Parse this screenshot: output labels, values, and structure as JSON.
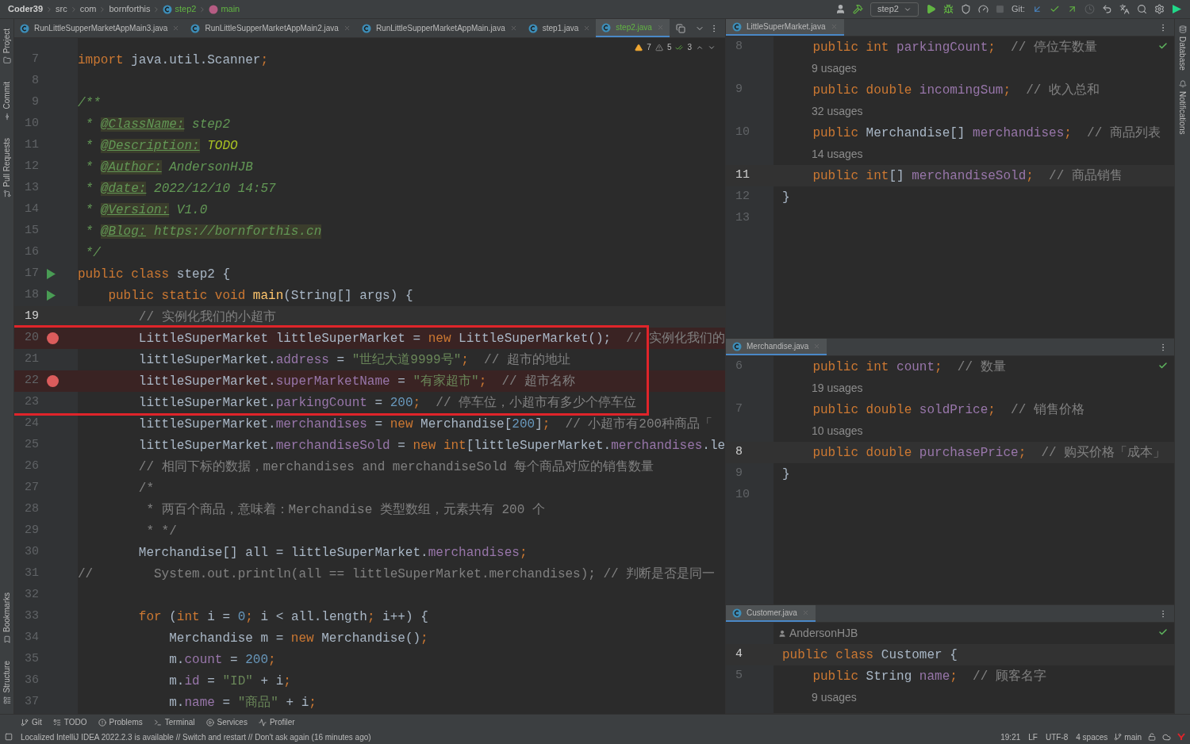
{
  "breadcrumbs": [
    {
      "kind": "project",
      "text": "Coder39"
    },
    {
      "kind": "folder",
      "text": "src"
    },
    {
      "kind": "folder",
      "text": "com"
    },
    {
      "kind": "folder",
      "text": "bornforthis"
    },
    {
      "kind": "class",
      "text": "step2"
    },
    {
      "kind": "method",
      "text": "main"
    }
  ],
  "toolbar": {
    "run_config": "step2",
    "git_label": "Git:"
  },
  "left_stripe": [
    {
      "kind": "project",
      "label": "Project"
    },
    {
      "kind": "commit",
      "label": "Commit"
    },
    {
      "kind": "pull",
      "label": "Pull Requests"
    },
    {
      "kind": "bookmarks",
      "label": "Bookmarks"
    },
    {
      "kind": "structure",
      "label": "Structure"
    }
  ],
  "right_stripe": [
    {
      "kind": "database",
      "label": "Database"
    },
    {
      "kind": "notifications",
      "label": "Notifications"
    }
  ],
  "editor_tabs": [
    {
      "label": "RunLittleSupperMarketAppMain3.java",
      "selected": false
    },
    {
      "label": "RunLittleSupperMarketAppMain2.java",
      "selected": false
    },
    {
      "label": "RunLittleSupperMarketAppMain.java",
      "selected": false
    },
    {
      "label": "step1.java",
      "selected": false
    },
    {
      "label": "step2.java",
      "selected": true
    }
  ],
  "inspections": {
    "warnings": "7",
    "weak_warnings": "5",
    "typos": "3"
  },
  "editor_lines": [
    {
      "n": "7",
      "current": false,
      "framed": false,
      "tokens": [
        {
          "kind": "kw",
          "text": "import"
        },
        {
          "kind": "plain",
          "text": " java.util.Scanner"
        },
        {
          "kind": "kw",
          "text": ";"
        }
      ]
    },
    {
      "n": "8",
      "current": false,
      "framed": false
    },
    {
      "n": "9",
      "current": false,
      "framed": false,
      "tokens": [
        {
          "kind": "doc",
          "text": "/**"
        }
      ]
    },
    {
      "n": "10",
      "current": false,
      "framed": false,
      "tokens": [
        {
          "kind": "doc",
          "text": " * "
        },
        {
          "kind": "doctag",
          "text": "@ClassName:"
        },
        {
          "kind": "doc",
          "text": " step2"
        }
      ]
    },
    {
      "n": "11",
      "current": false,
      "framed": false,
      "tokens": [
        {
          "kind": "doc",
          "text": " * "
        },
        {
          "kind": "doctag",
          "text": "@Description:"
        },
        {
          "kind": "todo",
          "text": " TODO"
        }
      ]
    },
    {
      "n": "12",
      "current": false,
      "framed": false,
      "tokens": [
        {
          "kind": "doc",
          "text": " * "
        },
        {
          "kind": "doctag",
          "text": "@Author:"
        },
        {
          "kind": "doc",
          "text": " AndersonHJB"
        }
      ]
    },
    {
      "n": "13",
      "current": false,
      "framed": false,
      "tokens": [
        {
          "kind": "doc",
          "text": " * "
        },
        {
          "kind": "doctag",
          "text": "@date:"
        },
        {
          "kind": "doc",
          "text": " 2022/12/10 14:57"
        }
      ]
    },
    {
      "n": "14",
      "current": false,
      "framed": false,
      "tokens": [
        {
          "kind": "doc",
          "text": " * "
        },
        {
          "kind": "doctag",
          "text": "@Version:"
        },
        {
          "kind": "doc",
          "text": " V1.0"
        }
      ]
    },
    {
      "n": "15",
      "current": false,
      "framed": false,
      "tokens": [
        {
          "kind": "doc",
          "text": " * "
        },
        {
          "kind": "doctag",
          "text": "@Blog:"
        },
        {
          "kind": "link",
          "text": " https://bornforthis.cn"
        }
      ]
    },
    {
      "n": "16",
      "current": false,
      "framed": false,
      "tokens": [
        {
          "kind": "doc",
          "text": " */"
        }
      ]
    },
    {
      "n": "17",
      "current": false,
      "framed": false,
      "runnable": true,
      "breakpoint": false,
      "tokens": [
        {
          "kind": "kw",
          "text": "public class"
        },
        {
          "kind": "plain",
          "text": " step2 {"
        }
      ]
    },
    {
      "n": "18",
      "current": false,
      "framed": false,
      "runnable": true,
      "breakpoint": false,
      "tokens": [
        {
          "kind": "kw",
          "text": "    public static void"
        },
        {
          "kind": "method",
          "text": " main"
        },
        {
          "kind": "plain",
          "text": "(String[] args) {"
        }
      ]
    },
    {
      "n": "19",
      "current": true,
      "framed": false,
      "tokens": [
        {
          "kind": "comment",
          "text": "        // 实例化我们的小超市"
        }
      ]
    },
    {
      "n": "20",
      "current": false,
      "framed": true,
      "runnable": false,
      "breakpoint": true,
      "tokens": [
        {
          "kind": "plain",
          "text": "        LittleSuperMarket littleSuperMarket = "
        },
        {
          "kind": "kw",
          "text": "new"
        },
        {
          "kind": "plain",
          "text": " LittleSuperMarket();"
        },
        {
          "kind": "comment",
          "text": "  // 实例化我们的"
        }
      ]
    },
    {
      "n": "21",
      "current": false,
      "framed": true,
      "tokens": [
        {
          "kind": "plain",
          "text": "        littleSuperMarket."
        },
        {
          "kind": "field",
          "text": "address"
        },
        {
          "kind": "plain",
          "text": " = "
        },
        {
          "kind": "str",
          "text": "\"世纪大道9999号\""
        },
        {
          "kind": "kw",
          "text": ";"
        },
        {
          "kind": "comment",
          "text": "  // 超市的地址"
        }
      ]
    },
    {
      "n": "22",
      "current": false,
      "framed": true,
      "runnable": false,
      "breakpoint": true,
      "tokens": [
        {
          "kind": "plain",
          "text": "        littleSuperMarket."
        },
        {
          "kind": "field",
          "text": "superMarketName"
        },
        {
          "kind": "plain",
          "text": " = "
        },
        {
          "kind": "str",
          "text": "\"有家超市\""
        },
        {
          "kind": "kw",
          "text": ";"
        },
        {
          "kind": "comment",
          "text": "  // 超市名称"
        }
      ]
    },
    {
      "n": "23",
      "current": false,
      "framed": true,
      "tokens": [
        {
          "kind": "plain",
          "text": "        littleSuperMarket."
        },
        {
          "kind": "field",
          "text": "parkingCount"
        },
        {
          "kind": "plain",
          "text": " = "
        },
        {
          "kind": "num",
          "text": "200"
        },
        {
          "kind": "kw",
          "text": ";"
        },
        {
          "kind": "comment",
          "text": "  // 停车位，小超市有多少个停车位"
        }
      ]
    },
    {
      "n": "24",
      "current": false,
      "framed": false,
      "tokens": [
        {
          "kind": "plain",
          "text": "        littleSuperMarket."
        },
        {
          "kind": "field",
          "text": "merchandises"
        },
        {
          "kind": "plain",
          "text": " = "
        },
        {
          "kind": "kw",
          "text": "new"
        },
        {
          "kind": "plain",
          "text": " Merchandise["
        },
        {
          "kind": "num",
          "text": "200"
        },
        {
          "kind": "plain",
          "text": "]"
        },
        {
          "kind": "kw",
          "text": ";"
        },
        {
          "kind": "comment",
          "text": "  // 小超市有200种商品「"
        }
      ]
    },
    {
      "n": "25",
      "current": false,
      "framed": false,
      "tokens": [
        {
          "kind": "plain",
          "text": "        littleSuperMarket."
        },
        {
          "kind": "field",
          "text": "merchandiseSold"
        },
        {
          "kind": "plain",
          "text": " = "
        },
        {
          "kind": "kw",
          "text": "new int"
        },
        {
          "kind": "plain",
          "text": "[littleSuperMarket."
        },
        {
          "kind": "field",
          "text": "merchandises"
        },
        {
          "kind": "plain",
          "text": ".le"
        }
      ]
    },
    {
      "n": "26",
      "current": false,
      "framed": false,
      "tokens": [
        {
          "kind": "comment",
          "text": "        // 相同下标的数据，merchandises and merchandiseSold 每个商品对应的销售数量"
        }
      ]
    },
    {
      "n": "27",
      "current": false,
      "framed": false,
      "tokens": [
        {
          "kind": "comment",
          "text": "        /*"
        }
      ]
    },
    {
      "n": "28",
      "current": false,
      "framed": false,
      "tokens": [
        {
          "kind": "comment",
          "text": "         * 两百个商品，意味着：Merchandise 类型数组，元素共有 200 个"
        }
      ]
    },
    {
      "n": "29",
      "current": false,
      "framed": false,
      "tokens": [
        {
          "kind": "comment",
          "text": "         * */"
        }
      ]
    },
    {
      "n": "30",
      "current": false,
      "framed": false,
      "tokens": [
        {
          "kind": "plain",
          "text": "        Merchandise[] all = littleSuperMarket."
        },
        {
          "kind": "field",
          "text": "merchandises"
        },
        {
          "kind": "kw",
          "text": ";"
        }
      ]
    },
    {
      "n": "31",
      "current": false,
      "framed": false,
      "tokens": [
        {
          "kind": "comment",
          "text": "//        System.out.println(all == littleSuperMarket.merchandises); // 判断是否是同一"
        }
      ]
    },
    {
      "n": "32",
      "current": false,
      "framed": false
    },
    {
      "n": "33",
      "current": false,
      "framed": false,
      "tokens": [
        {
          "kind": "kw",
          "text": "        for"
        },
        {
          "kind": "plain",
          "text": " ("
        },
        {
          "kind": "kw",
          "text": "int"
        },
        {
          "kind": "plain",
          "text": " i = "
        },
        {
          "kind": "num",
          "text": "0"
        },
        {
          "kind": "kw",
          "text": ";"
        },
        {
          "kind": "plain",
          "text": " i < all.length"
        },
        {
          "kind": "kw",
          "text": ";"
        },
        {
          "kind": "plain",
          "text": " i++) {"
        }
      ]
    },
    {
      "n": "34",
      "current": false,
      "framed": false,
      "tokens": [
        {
          "kind": "plain",
          "text": "            Merchandise m = "
        },
        {
          "kind": "kw",
          "text": "new"
        },
        {
          "kind": "plain",
          "text": " Merchandise()"
        },
        {
          "kind": "kw",
          "text": ";"
        }
      ]
    },
    {
      "n": "35",
      "current": false,
      "framed": false,
      "tokens": [
        {
          "kind": "plain",
          "text": "            m."
        },
        {
          "kind": "field",
          "text": "count"
        },
        {
          "kind": "plain",
          "text": " = "
        },
        {
          "kind": "num",
          "text": "200"
        },
        {
          "kind": "kw",
          "text": ";"
        }
      ]
    },
    {
      "n": "36",
      "current": false,
      "framed": false,
      "tokens": [
        {
          "kind": "plain",
          "text": "            m."
        },
        {
          "kind": "field",
          "text": "id"
        },
        {
          "kind": "plain",
          "text": " = "
        },
        {
          "kind": "str",
          "text": "\"ID\""
        },
        {
          "kind": "plain",
          "text": " + i"
        },
        {
          "kind": "kw",
          "text": ";"
        }
      ]
    },
    {
      "n": "37",
      "current": false,
      "framed": false,
      "tokens": [
        {
          "kind": "plain",
          "text": "            m."
        },
        {
          "kind": "field",
          "text": "name"
        },
        {
          "kind": "plain",
          "text": " = "
        },
        {
          "kind": "str",
          "text": "\"商品\""
        },
        {
          "kind": "plain",
          "text": " + i"
        },
        {
          "kind": "kw",
          "text": ";"
        }
      ]
    }
  ],
  "side_panels": [
    {
      "tab": "LittleSuperMarket.java",
      "rows": [
        {
          "kind": "code",
          "n": "8",
          "current": false,
          "tokens": [
            {
              "kind": "kw",
              "text": "    public int"
            },
            {
              "kind": "field",
              "text": " parkingCount"
            },
            {
              "kind": "kw",
              "text": ";"
            },
            {
              "kind": "comment",
              "text": "  // 停位车数量"
            }
          ]
        },
        {
          "kind": "usages",
          "text": "9 usages"
        },
        {
          "kind": "code",
          "n": "9",
          "current": false,
          "tokens": [
            {
              "kind": "kw",
              "text": "    public double"
            },
            {
              "kind": "field",
              "text": " incomingSum"
            },
            {
              "kind": "kw",
              "text": ";"
            },
            {
              "kind": "comment",
              "text": "  // 收入总和"
            }
          ]
        },
        {
          "kind": "usages",
          "text": "32 usages"
        },
        {
          "kind": "code",
          "n": "10",
          "current": false,
          "tokens": [
            {
              "kind": "kw",
              "text": "    public"
            },
            {
              "kind": "plain",
              "text": " Merchandise[]"
            },
            {
              "kind": "field",
              "text": " merchandises"
            },
            {
              "kind": "kw",
              "text": ";"
            },
            {
              "kind": "comment",
              "text": "  // 商品列表"
            }
          ]
        },
        {
          "kind": "usages",
          "text": "14 usages"
        },
        {
          "kind": "code",
          "n": "11",
          "current": true,
          "tokens": [
            {
              "kind": "kw",
              "text": "    public int"
            },
            {
              "kind": "plain",
              "text": "[]"
            },
            {
              "kind": "field",
              "text": " merchandiseSold"
            },
            {
              "kind": "kw",
              "text": ";"
            },
            {
              "kind": "comment",
              "text": "  // 商品销售"
            }
          ]
        },
        {
          "kind": "code",
          "n": "12",
          "current": false,
          "tokens": [
            {
              "kind": "plain",
              "text": "}"
            }
          ]
        },
        {
          "kind": "code",
          "n": "13",
          "current": false
        }
      ]
    },
    {
      "tab": "Merchandise.java",
      "rows": [
        {
          "kind": "code",
          "n": "6",
          "current": false,
          "tokens": [
            {
              "kind": "kw",
              "text": "    public int"
            },
            {
              "kind": "field",
              "text": " count"
            },
            {
              "kind": "kw",
              "text": ";"
            },
            {
              "kind": "comment",
              "text": "  // 数量"
            }
          ]
        },
        {
          "kind": "usages",
          "text": "19 usages"
        },
        {
          "kind": "code",
          "n": "7",
          "current": false,
          "tokens": [
            {
              "kind": "kw",
              "text": "    public double"
            },
            {
              "kind": "field",
              "text": " soldPrice"
            },
            {
              "kind": "kw",
              "text": ";"
            },
            {
              "kind": "comment",
              "text": "  // 销售价格"
            }
          ]
        },
        {
          "kind": "usages",
          "text": "10 usages"
        },
        {
          "kind": "code",
          "n": "8",
          "current": true,
          "tokens": [
            {
              "kind": "kw",
              "text": "    public double"
            },
            {
              "kind": "field",
              "text": " purchasePrice"
            },
            {
              "kind": "kw",
              "text": ";"
            },
            {
              "kind": "comment",
              "text": "  // 购买价格「成本」"
            }
          ]
        },
        {
          "kind": "code",
          "n": "9",
          "current": false,
          "tokens": [
            {
              "kind": "plain",
              "text": "}"
            }
          ]
        },
        {
          "kind": "code",
          "n": "10",
          "current": false
        }
      ]
    },
    {
      "tab": "Customer.java",
      "rows": [
        {
          "kind": "author",
          "text": "AndersonHJB"
        },
        {
          "kind": "code",
          "n": "4",
          "current": true,
          "tokens": [
            {
              "kind": "kw",
              "text": "public class"
            },
            {
              "kind": "plain",
              "text": " Customer {"
            }
          ]
        },
        {
          "kind": "code",
          "n": "5",
          "current": false,
          "tokens": [
            {
              "kind": "kw",
              "text": "    public"
            },
            {
              "kind": "plain",
              "text": " String"
            },
            {
              "kind": "field",
              "text": " name"
            },
            {
              "kind": "kw",
              "text": ";"
            },
            {
              "kind": "comment",
              "text": "  // 顾客名字"
            }
          ]
        },
        {
          "kind": "usages",
          "text": "9 usages"
        }
      ]
    }
  ],
  "tool_windows": [
    {
      "kind": "git",
      "label": "Git"
    },
    {
      "kind": "todo",
      "label": "TODO"
    },
    {
      "kind": "problems",
      "label": "Problems"
    },
    {
      "kind": "terminal",
      "label": "Terminal"
    },
    {
      "kind": "services",
      "label": "Services"
    },
    {
      "kind": "profiler",
      "label": "Profiler"
    }
  ],
  "status_bar": {
    "message": "Localized IntelliJ IDEA 2022.2.3 is available // Switch and restart // Don't ask again (16 minutes ago)",
    "position": "19:21",
    "line_separator": "LF",
    "encoding": "UTF-8",
    "indent": "4 spaces",
    "branch": "main"
  }
}
